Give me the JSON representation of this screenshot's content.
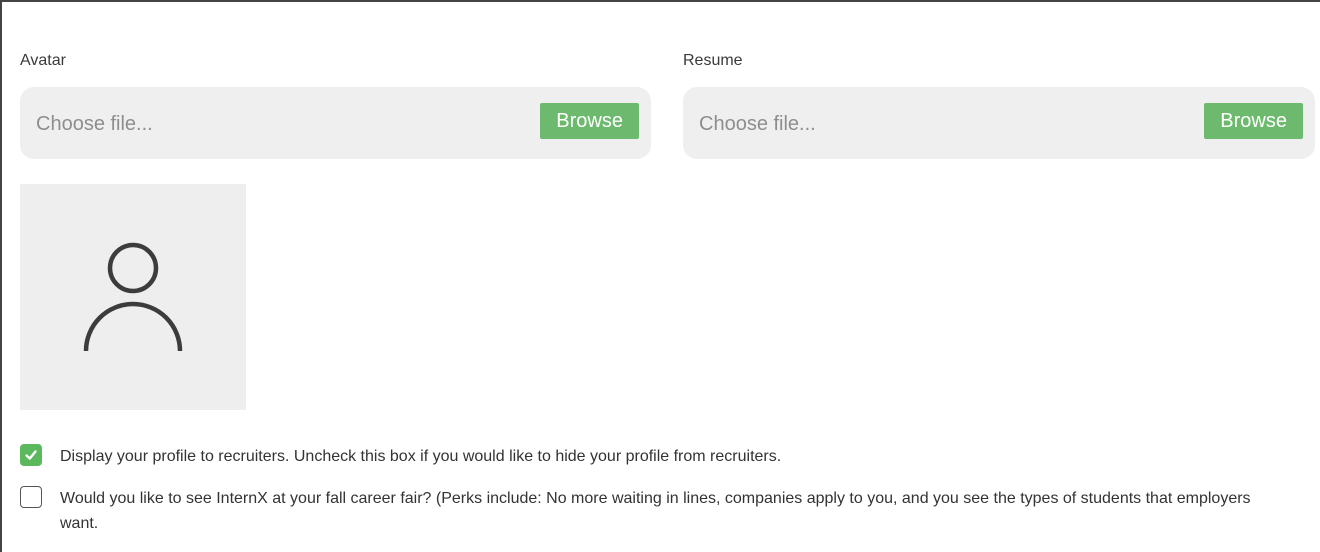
{
  "avatar_field": {
    "label": "Avatar",
    "placeholder": "Choose file...",
    "browse_label": "Browse"
  },
  "resume_field": {
    "label": "Resume",
    "placeholder": "Choose file...",
    "browse_label": "Browse"
  },
  "avatar_preview": {
    "icon": "user-icon"
  },
  "options": [
    {
      "checked": true,
      "text": "Display your profile to recruiters. Uncheck this box if you would like to hide your profile from recruiters."
    },
    {
      "checked": false,
      "text": "Would you like to see InternX at your fall career fair? (Perks include: No more waiting in lines, companies apply to you, and you see the types of students that employers want."
    }
  ],
  "colors": {
    "browse_button": "#6dba6e",
    "checkbox_checked": "#5cb85c",
    "file_field_bg": "#efefef"
  }
}
